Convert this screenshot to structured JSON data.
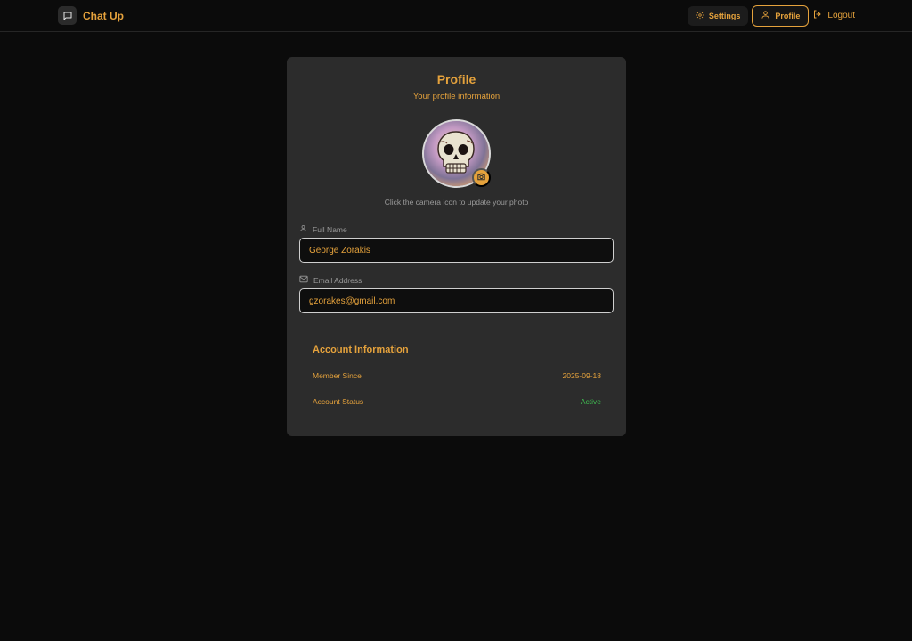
{
  "app": {
    "name": "Chat Up"
  },
  "nav": {
    "settings_label": "Settings",
    "profile_label": "Profile",
    "logout_label": "Logout"
  },
  "profile": {
    "title": "Profile",
    "subtitle": "Your profile information",
    "photo_hint": "Click the camera icon to update your photo",
    "full_name_label": "Full Name",
    "full_name_value": "George Zorakis",
    "email_label": "Email Address",
    "email_value": "gzorakes@gmail.com"
  },
  "account": {
    "title": "Account Information",
    "member_since_label": "Member Since",
    "member_since_value": "2025-09-18",
    "status_label": "Account Status",
    "status_value": "Active"
  },
  "colors": {
    "accent": "#e5a23c",
    "background": "#0b0b0b",
    "card": "#2c2c2c",
    "status_active": "#3fb950"
  },
  "icons": {
    "brand": "chat-bubble-icon",
    "settings": "gear-icon",
    "profile": "user-icon",
    "logout": "logout-icon",
    "camera": "camera-icon",
    "full_name": "user-icon",
    "email": "mail-icon"
  }
}
